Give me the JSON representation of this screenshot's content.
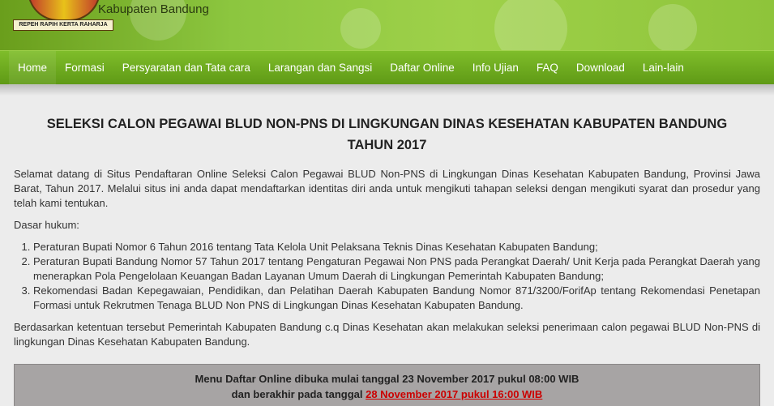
{
  "header": {
    "subtitle": "Kabupaten Bandung",
    "logo_motto": "REPEH RAPIH KERTA RAHARJA"
  },
  "nav": {
    "items": [
      "Home",
      "Formasi",
      "Persyaratan dan Tata cara",
      "Larangan dan Sangsi",
      "Daftar Online",
      "Info Ujian",
      "FAQ",
      "Download",
      "Lain-lain"
    ]
  },
  "main": {
    "title": "SELEKSI CALON PEGAWAI BLUD NON-PNS DI LINGKUNGAN DINAS KESEHATAN KABUPATEN BANDUNG TAHUN 2017",
    "intro": "Selamat datang di Situs Pendaftaran Online Seleksi Calon Pegawai BLUD Non-PNS di Lingkungan Dinas Kesehatan Kabupaten Bandung, Provinsi Jawa Barat, Tahun 2017. Melalui situs ini anda dapat mendaftarkan identitas diri anda untuk mengikuti tahapan seleksi dengan mengikuti syarat dan prosedur yang telah kami tentukan.",
    "legal_heading": "Dasar hukum:",
    "legal_items": [
      "Peraturan Bupati Nomor 6 Tahun 2016 tentang Tata Kelola Unit Pelaksana Teknis Dinas Kesehatan Kabupaten Bandung;",
      "Peraturan Bupati Bandung Nomor 57 Tahun 2017 tentang Pengaturan Pegawai Non PNS pada Perangkat Daerah/ Unit Kerja pada Perangkat Daerah yang menerapkan Pola Pengelolaan Keuangan Badan Layanan Umum Daerah di Lingkungan Pemerintah Kabupaten Bandung;",
      "Rekomendasi Badan Kepegawaian, Pendidikan, dan Pelatihan Daerah Kabupaten Bandung Nomor 871/3200/ForifAp tentang Rekomendasi Penetapan Formasi untuk Rekrutmen Tenaga BLUD Non PNS di Lingkungan Dinas Kesehatan Kabupaten Bandung."
    ],
    "closing": "Berdasarkan ketentuan tersebut Pemerintah Kabupaten Bandung c.q Dinas Kesehatan akan melakukan seleksi penerimaan calon pegawai BLUD Non-PNS di lingkungan Dinas Kesehatan Kabupaten Bandung."
  },
  "notice": {
    "line1": "Menu Daftar Online dibuka mulai tanggal 23 November 2017 pukul 08:00 WIB",
    "line2_prefix": "dan berakhir pada tanggal ",
    "line2_deadline": "28 November 2017 pukul 16:00 WIB",
    "deadline_color": "#cc0000"
  },
  "colors": {
    "nav_green": "#6aa61c",
    "header_green": "#8cc63f"
  }
}
